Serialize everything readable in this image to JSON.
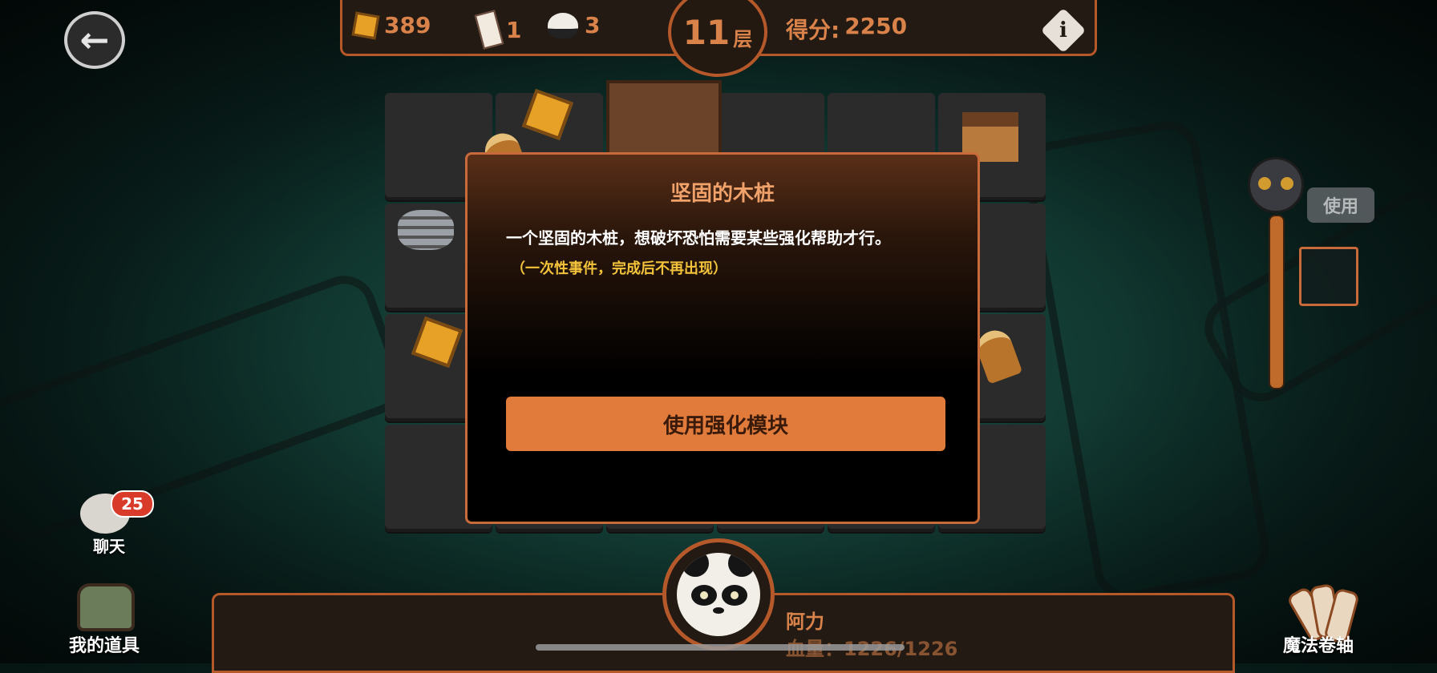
{
  "top_bar": {
    "gold_count": "389",
    "scroll_count": "1",
    "rice_count": "3",
    "floor_number": "11",
    "floor_unit": "层",
    "score_label": "得分:",
    "score_value": "2250",
    "info_symbol": "i"
  },
  "back_button": {
    "icon": "arrow-left-icon",
    "symbol": "←"
  },
  "modal": {
    "title": "坚固的木桩",
    "description": "一个坚固的木桩，想破坏恐怕需要某些强化帮助才行。",
    "note": "（一次性事件，完成后不再出现）",
    "action_label": "使用强化模块"
  },
  "side_tools": {
    "use_label": "使用"
  },
  "chat": {
    "badge_count": "25",
    "label": "聊天"
  },
  "bottom_left": {
    "label": "我的道具"
  },
  "bottom_right": {
    "label": "魔法卷轴"
  },
  "hero": {
    "name": "阿力",
    "hp_text": "血量：1226/1226"
  },
  "colors": {
    "accent": "#b5582a",
    "button": "#e07b3b",
    "title": "#f0a26a",
    "note": "#f3c33c"
  }
}
